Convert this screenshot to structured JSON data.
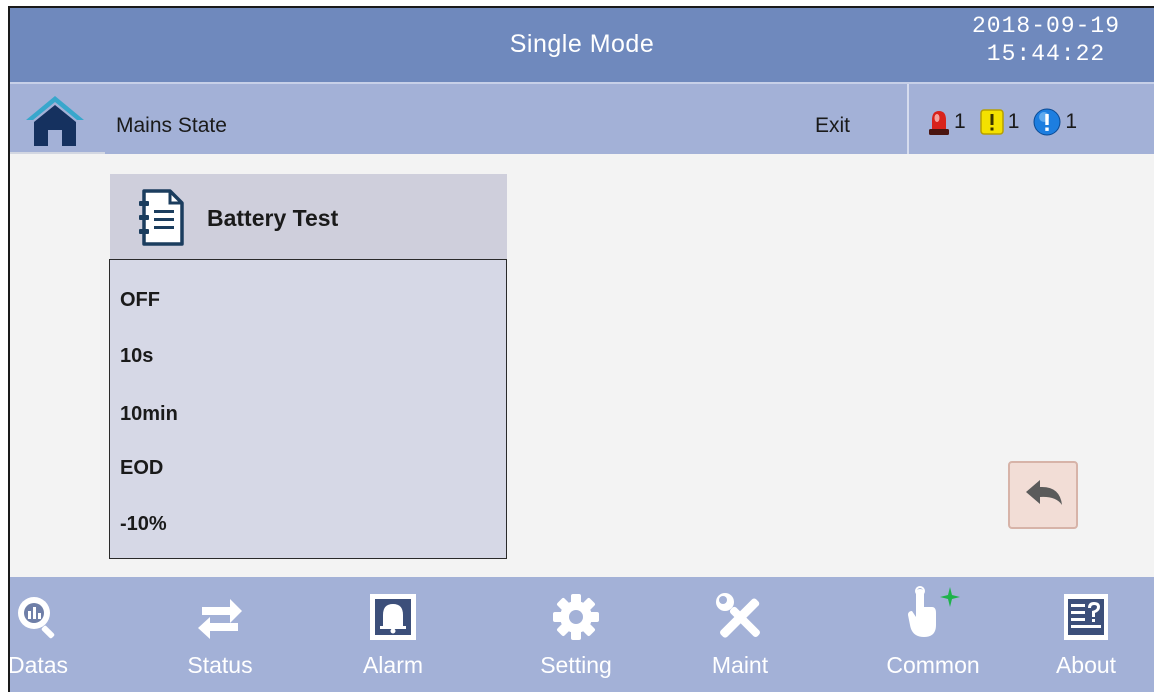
{
  "header": {
    "title": "Single Mode",
    "date": "2018-09-19",
    "time": "15:44:22"
  },
  "subheader": {
    "page_name": "Mains State",
    "exit_label": "Exit",
    "alarms": [
      {
        "icon": "red-siren-icon",
        "count": "1",
        "color": "#d8231b"
      },
      {
        "icon": "yellow-warning-icon",
        "count": "1",
        "color": "#f4e100"
      },
      {
        "icon": "blue-info-icon",
        "count": "1",
        "color": "#1d7ee0"
      }
    ]
  },
  "panel": {
    "title": "Battery Test",
    "values": [
      "OFF",
      "10s",
      "10min",
      "EOD",
      "-10%"
    ]
  },
  "footer": {
    "items": [
      {
        "label": "Datas",
        "icon": "datas-icon"
      },
      {
        "label": "Status",
        "icon": "status-arrows-icon"
      },
      {
        "label": "Alarm",
        "icon": "alarm-bell-icon"
      },
      {
        "label": "Setting",
        "icon": "gear-icon"
      },
      {
        "label": "Maint",
        "icon": "maintenance-tools-icon"
      },
      {
        "label": "Common",
        "icon": "touch-hand-icon"
      },
      {
        "label": "About",
        "icon": "about-document-icon"
      }
    ]
  }
}
